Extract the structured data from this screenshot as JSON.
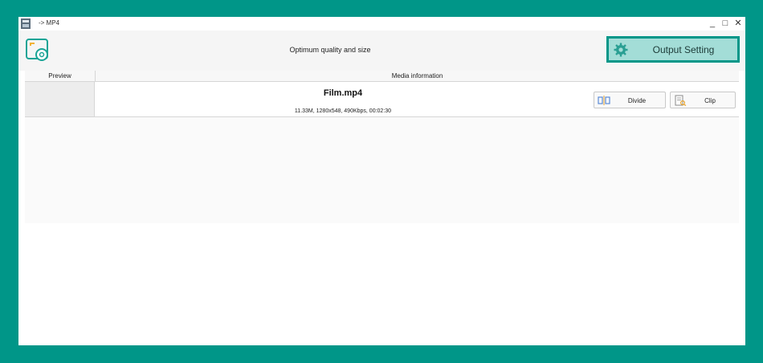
{
  "window": {
    "title": "-> MP4"
  },
  "window_controls": {
    "minimize": "_",
    "maximize": "□",
    "close": "✕"
  },
  "header": {
    "quality_label": "Optimum quality and size"
  },
  "output_setting": {
    "label": "Output Setting"
  },
  "table": {
    "columns": [
      "Preview",
      "Media information"
    ],
    "rows": [
      {
        "file_name": "Film.mp4",
        "meta": "11.33M, 1280x548, 490Kbps, 00:02:30",
        "divide_label": "Divide",
        "clip_label": "Clip"
      }
    ]
  },
  "colors": {
    "accent": "#009688",
    "button_fill": "#a3ddd7"
  }
}
